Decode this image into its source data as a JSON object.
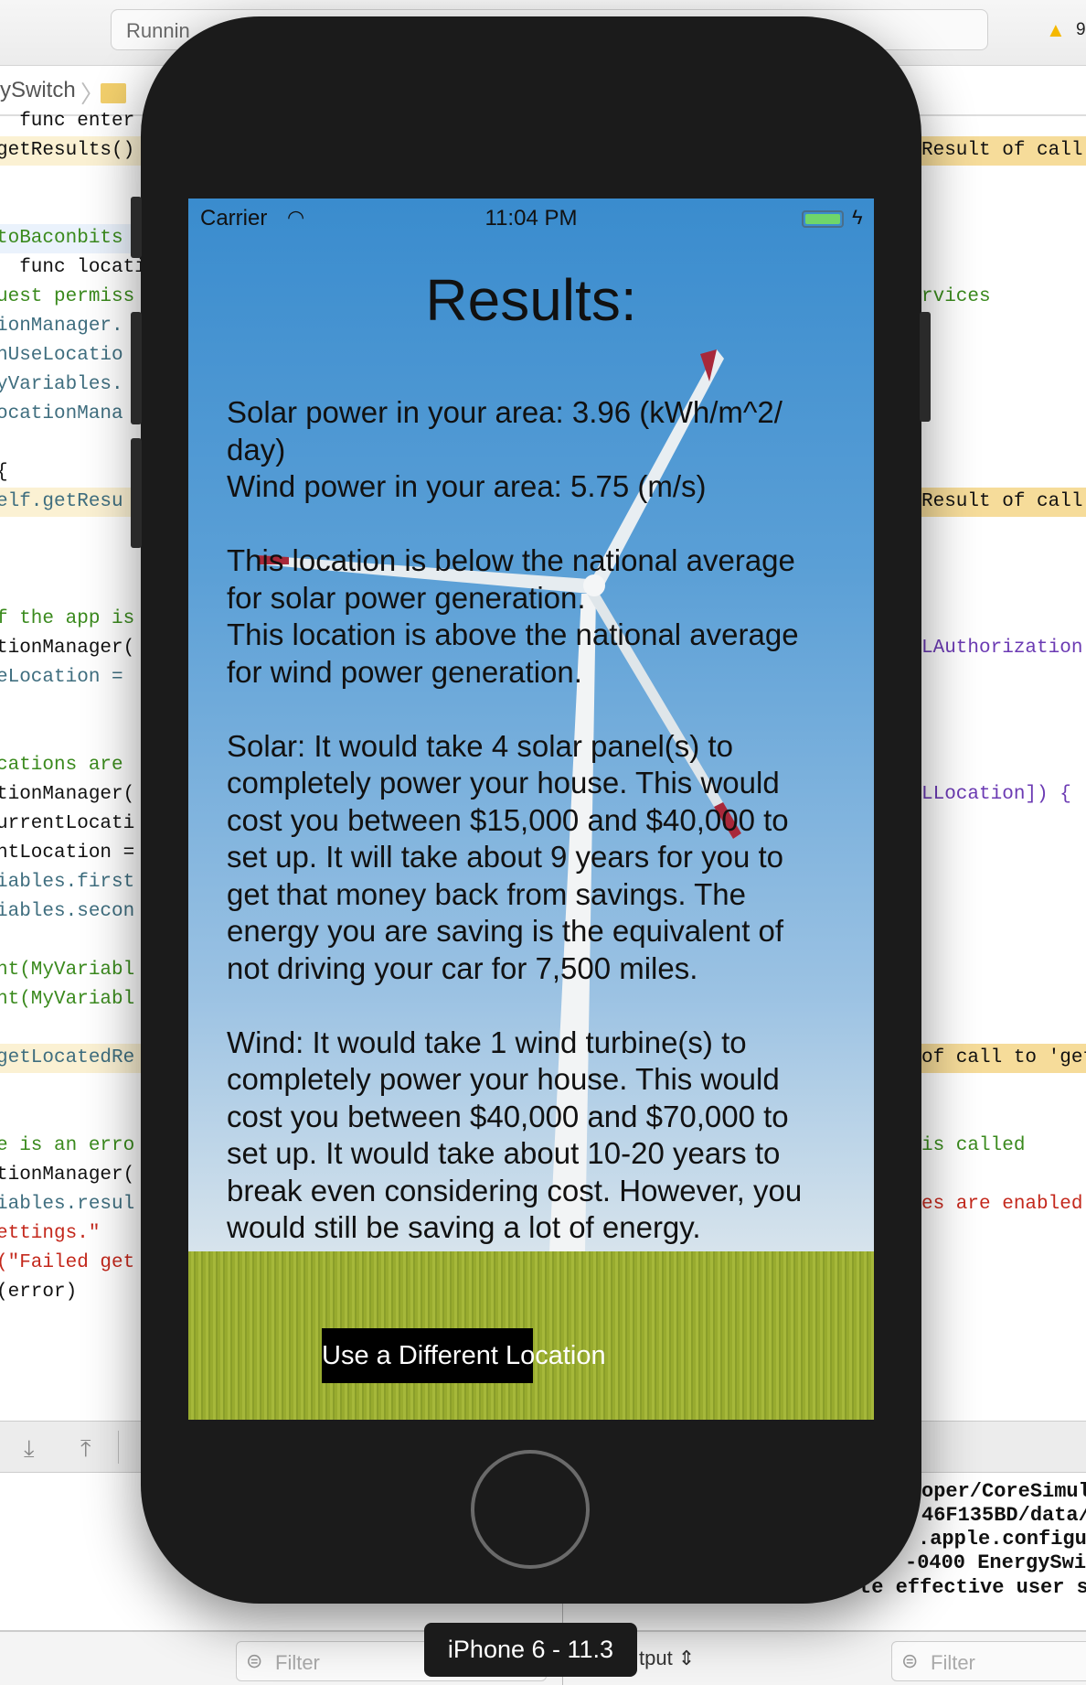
{
  "toolbar": {
    "status": "Runnin",
    "warning_count": "9"
  },
  "breadcrumb": {
    "project": "ySwitch",
    "folder": "E"
  },
  "code_left": [
    {
      "line": 0,
      "text": "  func enter",
      "cls": "b"
    },
    {
      "line": 1,
      "text": "getResults()",
      "cls": "b",
      "hl": "hl"
    },
    {
      "line": 4,
      "text": "toBaconbits",
      "cls": "g",
      "hl": "hlb"
    },
    {
      "line": 5,
      "text": "  func locati",
      "cls": "b"
    },
    {
      "line": 6,
      "text": "uest permiss",
      "cls": "g"
    },
    {
      "line": 7,
      "text": "ionManager.",
      "cls": "t"
    },
    {
      "line": 8,
      "text": "nUseLocatio",
      "cls": "t"
    },
    {
      "line": 9,
      "text": "yVariables.",
      "cls": "t"
    },
    {
      "line": 10,
      "text": "ocationMana",
      "cls": "t"
    },
    {
      "line": 12,
      "text": "{",
      "cls": "b"
    },
    {
      "line": 13,
      "text": "elf.getResu",
      "cls": "t",
      "hl": "hl"
    },
    {
      "line": 17,
      "text": "f the app is",
      "cls": "g"
    },
    {
      "line": 18,
      "text": "tionManager(",
      "cls": "b"
    },
    {
      "line": 19,
      "text": "eLocation =",
      "cls": "t"
    },
    {
      "line": 22,
      "text": "cations are",
      "cls": "g"
    },
    {
      "line": 23,
      "text": "tionManager(",
      "cls": "b"
    },
    {
      "line": 24,
      "text": "urrentLocati",
      "cls": "b"
    },
    {
      "line": 25,
      "text": "ntLocation =",
      "cls": "b"
    },
    {
      "line": 26,
      "text": "iables.first",
      "cls": "t"
    },
    {
      "line": 27,
      "text": "iables.secon",
      "cls": "t"
    },
    {
      "line": 29,
      "text": "nt(MyVariabl",
      "cls": "g"
    },
    {
      "line": 30,
      "text": "nt(MyVariabl",
      "cls": "g"
    },
    {
      "line": 32,
      "text": "getLocatedRe",
      "cls": "t",
      "hl": "hl"
    },
    {
      "line": 35,
      "text": "e is an erro",
      "cls": "g"
    },
    {
      "line": 36,
      "text": "tionManager(",
      "cls": "b"
    },
    {
      "line": 37,
      "text": "iables.resul",
      "cls": "t"
    },
    {
      "line": 38,
      "text": "ettings.\"",
      "cls": "r"
    },
    {
      "line": 39,
      "text": "(\"Failed get",
      "cls": "r"
    },
    {
      "line": 40,
      "text": "(error)",
      "cls": "b"
    }
  ],
  "code_right": [
    {
      "line": 1,
      "text": "Result of call to '",
      "cls": "b",
      "hl": "rhl"
    },
    {
      "line": 6,
      "text": "rvices",
      "cls": "g"
    },
    {
      "line": 13,
      "text": "Result of call to '",
      "cls": "b",
      "hl": "rhl"
    },
    {
      "line": 18,
      "text": "LAuthorization",
      "cls": "p"
    },
    {
      "line": 23,
      "text": "LLocation]) {",
      "cls": "p"
    },
    {
      "line": 32,
      "text": "of call to 'getLoca",
      "cls": "b",
      "hl": "rhl"
    },
    {
      "line": 35,
      "text": "is called",
      "cls": "g"
    },
    {
      "line": 37,
      "text": "es are enabled",
      "cls": "r"
    }
  ],
  "console": [
    "oper/CoreSimul",
    "46F135BD/data/",
    ".apple.configu",
    "-0400 EnergySwi",
    "te effective user s"
  ],
  "bottom": {
    "filter_placeholder": "Filter",
    "output_label": "tput ⇕"
  },
  "simulator": {
    "device_label": "iPhone 6 - 11.3",
    "status_bar": {
      "carrier": "Carrier",
      "time": "11:04 PM",
      "battery_level": 1.0,
      "charging": true
    },
    "title": "Results:",
    "body_lines": [
      "Solar power in your area: 3.96 (kWh/m^2/",
      "day)",
      "Wind power in your area: 5.75 (m/s)",
      "",
      "This location is below the national average",
      "for solar power generation.",
      "This location is above the national average",
      "for wind power generation.",
      "",
      "Solar: It would take 4 solar panel(s) to",
      "completely power your house. This would",
      "cost you between $15,000 and $40,000 to",
      "set up. It will take about 9 years for you to",
      "get that money back from savings. The",
      "energy you are saving is the equivalent of",
      "not driving your car for 7,500 miles.",
      "",
      "Wind: It would take 1 wind turbine(s) to",
      "completely power your house. This would",
      "cost you between $40,000 and $70,000 to",
      "set up. It would take about 10-20 years to",
      "break even considering cost. However, you",
      "would still be saving a lot of energy."
    ],
    "button_label": "Use a Different Location"
  },
  "colors": {
    "phone_body": "#1b1b1b",
    "battery": "#6fd66a",
    "button_bg": "#000000"
  }
}
